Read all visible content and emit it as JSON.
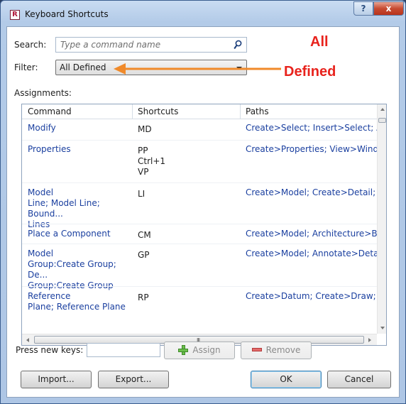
{
  "window": {
    "title": "Keyboard Shortcuts",
    "help_label": "?",
    "close_label": "x"
  },
  "search": {
    "label": "Search:",
    "placeholder": "Type a command name"
  },
  "filter": {
    "label": "Filter:",
    "selected": "All Defined"
  },
  "annotation": {
    "line1": "All",
    "line2": "Defined",
    "color": "#e8231d",
    "arrow_color": "#f08a2a"
  },
  "assignments_label": "Assignments:",
  "table": {
    "headers": {
      "command": "Command",
      "shortcuts": "Shortcuts",
      "paths": "Paths"
    },
    "rows": [
      {
        "command": "Modify",
        "shortcuts": "MD",
        "paths": "Create>Select; Insert>Select; Ann..."
      },
      {
        "command": "Properties",
        "shortcuts": "PP\nCtrl+1\nVP",
        "paths": "Create>Properties; View>Windo..."
      },
      {
        "command": "Model\nLine; Model Line; Bound...\nLines",
        "shortcuts": "LI",
        "paths": "Create>Model; Create>Detail; Cr..."
      },
      {
        "command": "Place a Component",
        "shortcuts": "CM",
        "paths": "Create>Model; Architecture>Buil..."
      },
      {
        "command": "Model\nGroup:Create Group; De...\nGroup:Create Group",
        "shortcuts": "GP",
        "paths": "Create>Model; Annotate>Detail;..."
      },
      {
        "command": "Reference\nPlane; Reference Plane",
        "shortcuts": "RP",
        "paths": "Create>Datum; Create>Draw; Mo..."
      }
    ],
    "hscroll_grip": "III"
  },
  "keys": {
    "label": "Press new keys:",
    "value": "",
    "assign_label": "Assign",
    "remove_label": "Remove"
  },
  "footer": {
    "import_label": "Import...",
    "export_label": "Export...",
    "ok_label": "OK",
    "cancel_label": "Cancel"
  }
}
